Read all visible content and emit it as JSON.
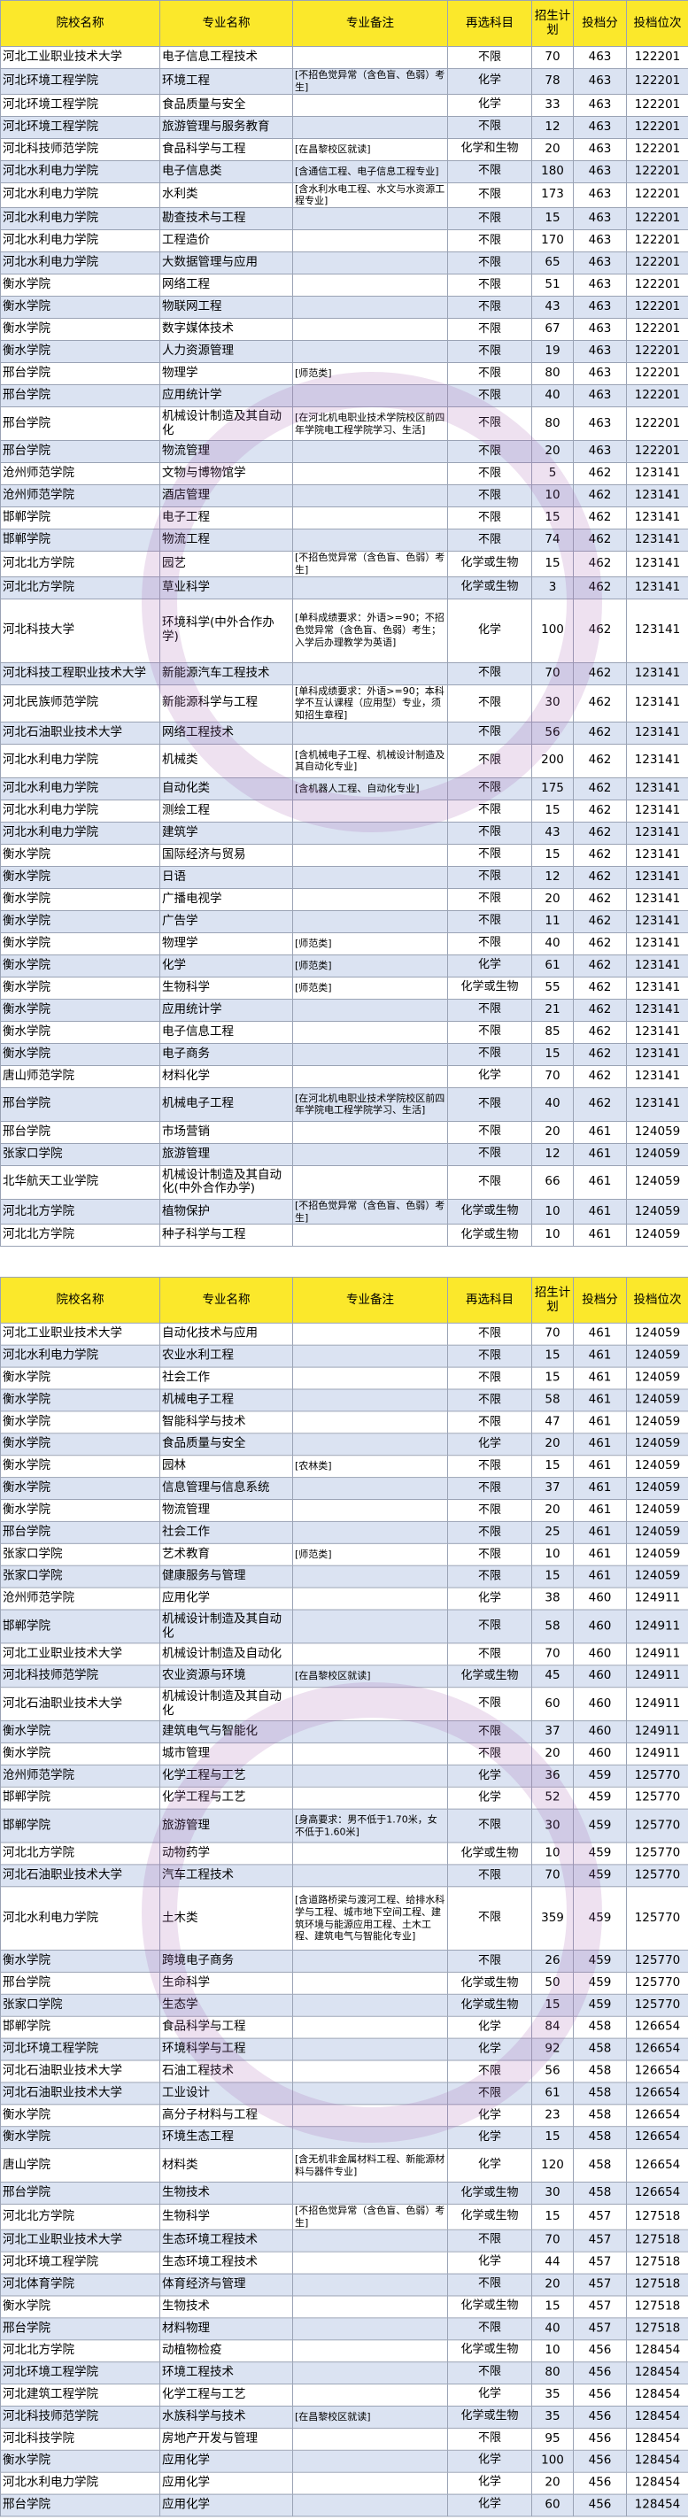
{
  "headers": [
    "院校名称",
    "专业名称",
    "专业备注",
    "再选科目",
    "招生计划",
    "投档分",
    "投档位次"
  ],
  "table1": [
    [
      "河北工业职业技术大学",
      "电子信息工程技术",
      "",
      "不限",
      "70",
      "463",
      "122201"
    ],
    [
      "河北环境工程学院",
      "环境工程",
      "[不招色觉异常（含色盲、色弱）考生]",
      "化学",
      "78",
      "463",
      "122201"
    ],
    [
      "河北环境工程学院",
      "食品质量与安全",
      "",
      "化学",
      "33",
      "463",
      "122201"
    ],
    [
      "河北环境工程学院",
      "旅游管理与服务教育",
      "",
      "不限",
      "12",
      "463",
      "122201"
    ],
    [
      "河北科技师范学院",
      "食品科学与工程",
      "[在昌黎校区就读]",
      "化学和生物",
      "20",
      "463",
      "122201"
    ],
    [
      "河北水利电力学院",
      "电子信息类",
      "[含通信工程、电子信息工程专业]",
      "不限",
      "180",
      "463",
      "122201"
    ],
    [
      "河北水利电力学院",
      "水利类",
      "[含水利水电工程、水文与水资源工程专业]",
      "不限",
      "173",
      "463",
      "122201"
    ],
    [
      "河北水利电力学院",
      "勘查技术与工程",
      "",
      "不限",
      "15",
      "463",
      "122201"
    ],
    [
      "河北水利电力学院",
      "工程造价",
      "",
      "不限",
      "170",
      "463",
      "122201"
    ],
    [
      "河北水利电力学院",
      "大数据管理与应用",
      "",
      "不限",
      "65",
      "463",
      "122201"
    ],
    [
      "衡水学院",
      "网络工程",
      "",
      "不限",
      "51",
      "463",
      "122201"
    ],
    [
      "衡水学院",
      "物联网工程",
      "",
      "不限",
      "43",
      "463",
      "122201"
    ],
    [
      "衡水学院",
      "数字媒体技术",
      "",
      "不限",
      "67",
      "463",
      "122201"
    ],
    [
      "衡水学院",
      "人力资源管理",
      "",
      "不限",
      "19",
      "463",
      "122201"
    ],
    [
      "邢台学院",
      "物理学",
      "[师范类]",
      "不限",
      "80",
      "463",
      "122201"
    ],
    [
      "邢台学院",
      "应用统计学",
      "",
      "不限",
      "40",
      "463",
      "122201"
    ],
    [
      "邢台学院",
      "机械设计制造及其自动化",
      "[在河北机电职业技术学院校区前四年学院电工程学院学习、生活]",
      "不限",
      "80",
      "463",
      "122201"
    ],
    [
      "邢台学院",
      "物流管理",
      "",
      "不限",
      "20",
      "463",
      "122201"
    ],
    [
      "沧州师范学院",
      "文物与博物馆学",
      "",
      "不限",
      "5",
      "462",
      "123141"
    ],
    [
      "沧州师范学院",
      "酒店管理",
      "",
      "不限",
      "10",
      "462",
      "123141"
    ],
    [
      "邯郸学院",
      "电子工程",
      "",
      "不限",
      "15",
      "462",
      "123141"
    ],
    [
      "邯郸学院",
      "物流工程",
      "",
      "不限",
      "74",
      "462",
      "123141"
    ],
    [
      "河北北方学院",
      "园艺",
      "[不招色觉异常（含色盲、色弱）考生]",
      "化学或生物",
      "15",
      "462",
      "123141"
    ],
    [
      "河北北方学院",
      "草业科学",
      "",
      "化学或生物",
      "3",
      "462",
      "123141"
    ],
    [
      "河北科技大学",
      "环境科学(中外合作办学)",
      "[单科成绩要求：外语>=90；不招色觉异常（含色盲、色弱）考生；入学后办理教学为英语]",
      "化学",
      "100",
      "462",
      "123141"
    ],
    [
      "河北科技工程职业技术大学",
      "新能源汽车工程技术",
      "",
      "不限",
      "70",
      "462",
      "123141"
    ],
    [
      "河北民族师范学院",
      "新能源科学与工程",
      "[单科成绩要求：外语>=90；本科学不互认课程（应用型）专业，须知招生章程]",
      "不限",
      "30",
      "462",
      "123141"
    ],
    [
      "河北石油职业技术大学",
      "网络工程技术",
      "",
      "不限",
      "56",
      "462",
      "123141"
    ],
    [
      "河北水利电力学院",
      "机械类",
      "[含机械电子工程、机械设计制造及其自动化专业]",
      "不限",
      "200",
      "462",
      "123141"
    ],
    [
      "河北水利电力学院",
      "自动化类",
      "[含机器人工程、自动化专业]",
      "不限",
      "175",
      "462",
      "123141"
    ],
    [
      "河北水利电力学院",
      "测绘工程",
      "",
      "不限",
      "15",
      "462",
      "123141"
    ],
    [
      "河北水利电力学院",
      "建筑学",
      "",
      "不限",
      "43",
      "462",
      "123141"
    ],
    [
      "衡水学院",
      "国际经济与贸易",
      "",
      "不限",
      "15",
      "462",
      "123141"
    ],
    [
      "衡水学院",
      "日语",
      "",
      "不限",
      "12",
      "462",
      "123141"
    ],
    [
      "衡水学院",
      "广播电视学",
      "",
      "不限",
      "20",
      "462",
      "123141"
    ],
    [
      "衡水学院",
      "广告学",
      "",
      "不限",
      "11",
      "462",
      "123141"
    ],
    [
      "衡水学院",
      "物理学",
      "[师范类]",
      "不限",
      "40",
      "462",
      "123141"
    ],
    [
      "衡水学院",
      "化学",
      "[师范类]",
      "化学",
      "61",
      "462",
      "123141"
    ],
    [
      "衡水学院",
      "生物科学",
      "[师范类]",
      "化学或生物",
      "55",
      "462",
      "123141"
    ],
    [
      "衡水学院",
      "应用统计学",
      "",
      "不限",
      "21",
      "462",
      "123141"
    ],
    [
      "衡水学院",
      "电子信息工程",
      "",
      "不限",
      "85",
      "462",
      "123141"
    ],
    [
      "衡水学院",
      "电子商务",
      "",
      "不限",
      "15",
      "462",
      "123141"
    ],
    [
      "唐山师范学院",
      "材料化学",
      "",
      "化学",
      "70",
      "462",
      "123141"
    ],
    [
      "邢台学院",
      "机械电子工程",
      "[在河北机电职业技术学院校区前四年学院电工程学院学习、生活]",
      "不限",
      "40",
      "462",
      "123141"
    ],
    [
      "邢台学院",
      "市场营销",
      "",
      "不限",
      "20",
      "461",
      "124059"
    ],
    [
      "张家口学院",
      "旅游管理",
      "",
      "不限",
      "12",
      "461",
      "124059"
    ],
    [
      "北华航天工业学院",
      "机械设计制造及其自动化(中外合作办学)",
      "",
      "不限",
      "66",
      "461",
      "124059"
    ],
    [
      "河北北方学院",
      "植物保护",
      "[不招色觉异常（含色盲、色弱）考生]",
      "化学或生物",
      "10",
      "461",
      "124059"
    ],
    [
      "河北北方学院",
      "种子科学与工程",
      "",
      "化学或生物",
      "10",
      "461",
      "124059"
    ]
  ],
  "table2": [
    [
      "河北工业职业技术大学",
      "自动化技术与应用",
      "",
      "不限",
      "70",
      "461",
      "124059"
    ],
    [
      "河北水利电力学院",
      "农业水利工程",
      "",
      "不限",
      "15",
      "461",
      "124059"
    ],
    [
      "衡水学院",
      "社会工作",
      "",
      "不限",
      "15",
      "461",
      "124059"
    ],
    [
      "衡水学院",
      "机械电子工程",
      "",
      "不限",
      "58",
      "461",
      "124059"
    ],
    [
      "衡水学院",
      "智能科学与技术",
      "",
      "不限",
      "47",
      "461",
      "124059"
    ],
    [
      "衡水学院",
      "食品质量与安全",
      "",
      "化学",
      "20",
      "461",
      "124059"
    ],
    [
      "衡水学院",
      "园林",
      "[农林类]",
      "不限",
      "15",
      "461",
      "124059"
    ],
    [
      "衡水学院",
      "信息管理与信息系统",
      "",
      "不限",
      "37",
      "461",
      "124059"
    ],
    [
      "衡水学院",
      "物流管理",
      "",
      "不限",
      "20",
      "461",
      "124059"
    ],
    [
      "邢台学院",
      "社会工作",
      "",
      "不限",
      "25",
      "461",
      "124059"
    ],
    [
      "张家口学院",
      "艺术教育",
      "[师范类]",
      "不限",
      "10",
      "461",
      "124059"
    ],
    [
      "张家口学院",
      "健康服务与管理",
      "",
      "不限",
      "15",
      "461",
      "124059"
    ],
    [
      "沧州师范学院",
      "应用化学",
      "",
      "化学",
      "38",
      "460",
      "124911"
    ],
    [
      "邯郸学院",
      "机械设计制造及其自动化",
      "",
      "不限",
      "58",
      "460",
      "124911"
    ],
    [
      "河北工业职业技术大学",
      "机械设计制造及自动化",
      "",
      "不限",
      "70",
      "460",
      "124911"
    ],
    [
      "河北科技师范学院",
      "农业资源与环境",
      "[在昌黎校区就读]",
      "化学或生物",
      "45",
      "460",
      "124911"
    ],
    [
      "河北石油职业技术大学",
      "机械设计制造及其自动化",
      "",
      "不限",
      "60",
      "460",
      "124911"
    ],
    [
      "衡水学院",
      "建筑电气与智能化",
      "",
      "不限",
      "37",
      "460",
      "124911"
    ],
    [
      "衡水学院",
      "城市管理",
      "",
      "不限",
      "20",
      "460",
      "124911"
    ],
    [
      "沧州师范学院",
      "化学工程与工艺",
      "",
      "化学",
      "36",
      "459",
      "125770"
    ],
    [
      "邯郸学院",
      "化学工程与工艺",
      "",
      "化学",
      "52",
      "459",
      "125770"
    ],
    [
      "邯郸学院",
      "旅游管理",
      "[身高要求：男不低于1.70米，女不低于1.60米]",
      "不限",
      "30",
      "459",
      "125770"
    ],
    [
      "河北北方学院",
      "动物药学",
      "",
      "化学或生物",
      "10",
      "459",
      "125770"
    ],
    [
      "河北石油职业技术大学",
      "汽车工程技术",
      "",
      "不限",
      "70",
      "459",
      "125770"
    ],
    [
      "河北水利电力学院",
      "土木类",
      "[含道路桥梁与渡河工程、给排水科学与工程、城市地下空间工程、建筑环境与能源应用工程、土木工程、建筑电气与智能化专业]",
      "不限",
      "359",
      "459",
      "125770"
    ],
    [
      "衡水学院",
      "跨境电子商务",
      "",
      "不限",
      "26",
      "459",
      "125770"
    ],
    [
      "邢台学院",
      "生命科学",
      "",
      "化学或生物",
      "50",
      "459",
      "125770"
    ],
    [
      "张家口学院",
      "生态学",
      "",
      "化学或生物",
      "15",
      "459",
      "125770"
    ],
    [
      "邯郸学院",
      "食品科学与工程",
      "",
      "化学",
      "84",
      "458",
      "126654"
    ],
    [
      "河北环境工程学院",
      "环境科学与工程",
      "",
      "化学",
      "92",
      "458",
      "126654"
    ],
    [
      "河北石油职业技术大学",
      "石油工程技术",
      "",
      "不限",
      "56",
      "458",
      "126654"
    ],
    [
      "河北石油职业技术大学",
      "工业设计",
      "",
      "不限",
      "61",
      "458",
      "126654"
    ],
    [
      "衡水学院",
      "高分子材料与工程",
      "",
      "化学",
      "23",
      "458",
      "126654"
    ],
    [
      "衡水学院",
      "环境生态工程",
      "",
      "化学",
      "15",
      "458",
      "126654"
    ],
    [
      "唐山学院",
      "材料类",
      "[含无机非金属材料工程、新能源材料与器件专业]",
      "化学",
      "120",
      "458",
      "126654"
    ],
    [
      "邢台学院",
      "生物技术",
      "",
      "化学或生物",
      "30",
      "458",
      "126654"
    ],
    [
      "河北北方学院",
      "生物科学",
      "[不招色觉异常（含色盲、色弱）考生]",
      "化学或生物",
      "15",
      "457",
      "127518"
    ],
    [
      "河北工业职业技术大学",
      "生态环境工程技术",
      "",
      "不限",
      "70",
      "457",
      "127518"
    ],
    [
      "河北环境工程学院",
      "生态环境工程技术",
      "",
      "化学",
      "44",
      "457",
      "127518"
    ],
    [
      "河北体育学院",
      "体育经济与管理",
      "",
      "不限",
      "20",
      "457",
      "127518"
    ],
    [
      "衡水学院",
      "生物技术",
      "",
      "化学或生物",
      "15",
      "457",
      "127518"
    ],
    [
      "邢台学院",
      "材料物理",
      "",
      "不限",
      "40",
      "457",
      "127518"
    ],
    [
      "河北北方学院",
      "动植物检疫",
      "",
      "化学或生物",
      "10",
      "456",
      "128454"
    ],
    [
      "河北环境工程学院",
      "环境工程技术",
      "",
      "不限",
      "80",
      "456",
      "128454"
    ],
    [
      "河北建筑工程学院",
      "化学工程与工艺",
      "",
      "化学",
      "35",
      "456",
      "128454"
    ],
    [
      "河北科技师范学院",
      "水族科学与技术",
      "[在昌黎校区就读]",
      "化学或生物",
      "35",
      "456",
      "128454"
    ],
    [
      "河北科技学院",
      "房地产开发与管理",
      "",
      "不限",
      "95",
      "456",
      "128454"
    ],
    [
      "衡水学院",
      "应用化学",
      "",
      "化学",
      "100",
      "456",
      "128454"
    ],
    [
      "河北水利电力学院",
      "应用化学",
      "",
      "化学",
      "20",
      "456",
      "128454"
    ],
    [
      "邢台学院",
      "应用化学",
      "",
      "化学",
      "60",
      "456",
      "128454"
    ]
  ]
}
